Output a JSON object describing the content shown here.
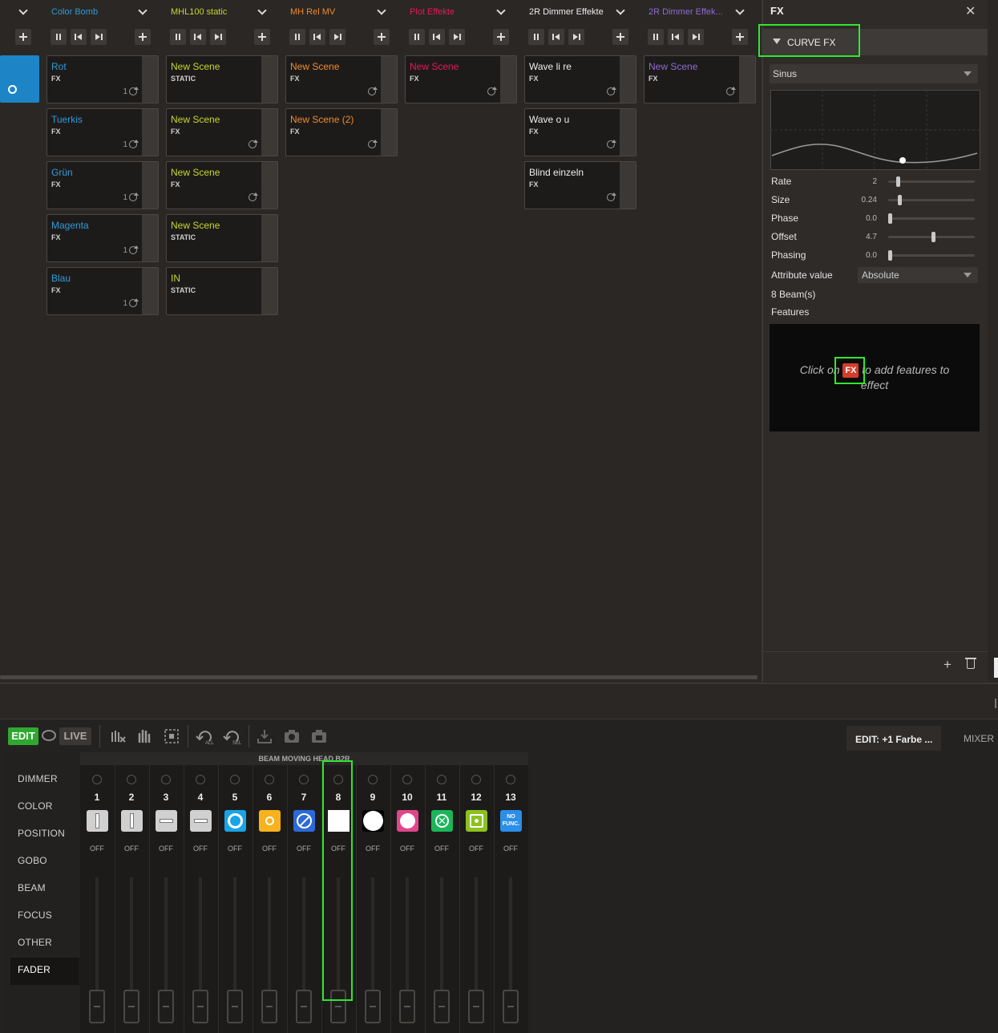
{
  "columns": [
    {
      "title": "Color Bomb",
      "color": "#2e9bd8",
      "scenes": [
        {
          "name": "Rot",
          "type": "FX",
          "count": "1"
        },
        {
          "name": "Tuerkis",
          "type": "FX",
          "count": "1"
        },
        {
          "name": "Grün",
          "type": "FX",
          "count": "1"
        },
        {
          "name": "Magenta",
          "type": "FX",
          "count": "1"
        },
        {
          "name": "Blau",
          "type": "FX",
          "count": "1"
        }
      ]
    },
    {
      "title": "MHL100 static",
      "color": "#c6d82a",
      "scenes": [
        {
          "name": "New Scene",
          "type": "STATIC"
        },
        {
          "name": "New Scene",
          "type": "FX"
        },
        {
          "name": "New Scene",
          "type": "FX"
        },
        {
          "name": "New Scene",
          "type": "STATIC"
        },
        {
          "name": "IN",
          "type": "STATIC"
        }
      ]
    },
    {
      "title": "MH Rel MV",
      "color": "#f08a2a",
      "scenes": [
        {
          "name": "New Scene",
          "type": "FX"
        },
        {
          "name": "New Scene (2)",
          "type": "FX"
        }
      ]
    },
    {
      "title": "Plot Effekte",
      "color": "#e5195a",
      "scenes": [
        {
          "name": "New Scene",
          "type": "FX"
        }
      ]
    },
    {
      "title": "2R Dimmer Effekte",
      "color": "#eeeeee",
      "scenes": [
        {
          "name": "Wave li re",
          "type": "FX"
        },
        {
          "name": "Wave o u",
          "type": "FX"
        },
        {
          "name": "Blind einzeln",
          "type": "FX"
        }
      ]
    },
    {
      "title": "2R Dimmer Effek...",
      "color": "#8e6bd1",
      "scenes": [
        {
          "name": "New Scene",
          "type": "FX"
        }
      ]
    }
  ],
  "fx": {
    "title": "FX",
    "section": "CURVE FX",
    "waveform": "Sinus",
    "params": [
      {
        "label": "Rate",
        "value": "2",
        "level": 0.1
      },
      {
        "label": "Size",
        "value": "0.24",
        "level": 0.12
      },
      {
        "label": "Phase",
        "value": "0.0",
        "level": 0.0
      },
      {
        "label": "Offset",
        "value": "4.7",
        "level": 0.52
      },
      {
        "label": "Phasing",
        "value": "0.0",
        "level": 0.0
      }
    ],
    "attribute_label": "Attribute value",
    "attribute_value": "Absolute",
    "beams": "8 Beam(s)",
    "features_label": "Features",
    "hint_before": "Click on",
    "hint_badge": "FX",
    "hint_after": "to add features to effect"
  },
  "bottom": {
    "edit": "EDIT",
    "live": "LIVE",
    "tab_edit": "EDIT: +1 Farbe ...",
    "tab_mixer": "MIXER",
    "group_title": "BEAM MOVING HEAD B2R",
    "categories": [
      "DIMMER",
      "COLOR",
      "POSITION",
      "GOBO",
      "BEAM",
      "FOCUS",
      "OTHER",
      "FADER"
    ],
    "active_category": "FADER",
    "channels": [
      {
        "num": "1",
        "state": "OFF"
      },
      {
        "num": "2",
        "state": "OFF"
      },
      {
        "num": "3",
        "state": "OFF"
      },
      {
        "num": "4",
        "state": "OFF"
      },
      {
        "num": "5",
        "state": "OFF"
      },
      {
        "num": "6",
        "state": "OFF"
      },
      {
        "num": "7",
        "state": "OFF"
      },
      {
        "num": "8",
        "state": "OFF"
      },
      {
        "num": "9",
        "state": "OFF"
      },
      {
        "num": "10",
        "state": "OFF"
      },
      {
        "num": "11",
        "state": "OFF"
      },
      {
        "num": "12",
        "state": "OFF"
      },
      {
        "num": "13",
        "state": "OFF"
      }
    ],
    "channel13_icon_text": "NO FUNC."
  }
}
